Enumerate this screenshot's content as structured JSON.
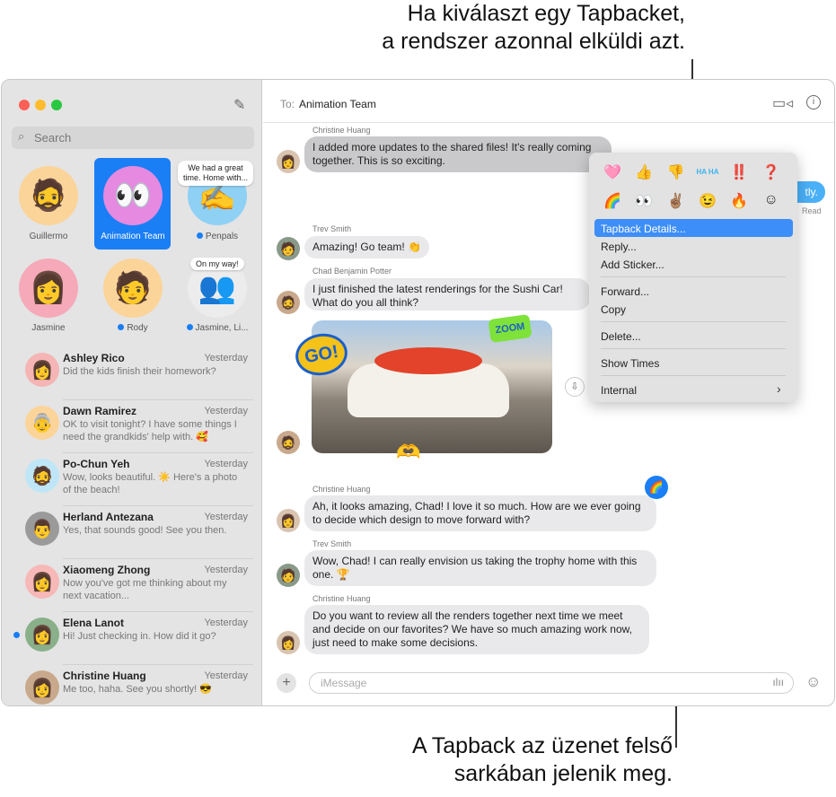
{
  "callouts": {
    "top": [
      "Ha kiválaszt egy Tapbacket,",
      "a rendszer azonnal elküldi azt."
    ],
    "bottom": [
      "A Tapback az üzenet felső",
      "sarkában jelenik meg."
    ]
  },
  "sidebar": {
    "search_placeholder": "Search",
    "pinned": [
      {
        "name": "Guillermo",
        "emoji": "🧔"
      },
      {
        "name": "Animation Team",
        "emoji": "👀"
      },
      {
        "name": "Penpals",
        "emoji": "✍️",
        "bubble": "We had a great time. Home with..."
      },
      {
        "name": "Jasmine",
        "emoji": "👩"
      },
      {
        "name": "Rody",
        "emoji": "🧑"
      },
      {
        "name": "Jasmine, Li...",
        "emoji": "👥",
        "bubble": "On my way!"
      }
    ],
    "conversations": [
      {
        "name": "Ashley Rico",
        "time": "Yesterday",
        "preview": "Did the kids finish their homework?",
        "emoji": "👩",
        "color": "#f5b5b5"
      },
      {
        "name": "Dawn Ramirez",
        "time": "Yesterday",
        "preview": "OK to visit tonight? I have some things I need the grandkids' help with. 🥰",
        "emoji": "👵",
        "color": "#fbd49a"
      },
      {
        "name": "Po-Chun Yeh",
        "time": "Yesterday",
        "preview": "Wow, looks beautiful. ☀️ Here's a photo of the beach!",
        "emoji": "🧔",
        "color": "#bfe6f7"
      },
      {
        "name": "Herland Antezana",
        "time": "Yesterday",
        "preview": "Yes, that sounds good! See you then.",
        "emoji": "👨",
        "color": "#9a9a9a"
      },
      {
        "name": "Xiaomeng Zhong",
        "time": "Yesterday",
        "preview": "Now you've got me thinking about my next vacation...",
        "emoji": "👩",
        "color": "#f7b8b8"
      },
      {
        "name": "Elena Lanot",
        "time": "Yesterday",
        "preview": "Hi! Just checking in. How did it go?",
        "emoji": "👩",
        "color": "#8ab08a",
        "unread": true
      },
      {
        "name": "Christine Huang",
        "time": "Yesterday",
        "preview": "Me too, haha. See you shortly! 😎",
        "emoji": "👩",
        "color": "#c9a98c"
      }
    ]
  },
  "header": {
    "to_label": "To:",
    "recipient": "Animation Team"
  },
  "messages": [
    {
      "sender": "Christine Huang",
      "text": "I added more updates to the shared files! It's really coming together. This is so exciting."
    },
    {
      "sender": "Trev Smith",
      "text": "Amazing! Go team! 👏"
    },
    {
      "sender": "Chad Benjamin Potter",
      "text": "I just finished the latest renderings for the Sushi Car! What do you all think?"
    },
    {
      "sender": "Christine Huang",
      "text": "Ah, it looks amazing, Chad! I love it so much. How are we ever going to decide which design to move forward with?",
      "tapback": "🌈"
    },
    {
      "sender": "Trev Smith",
      "text": "Wow, Chad! I can really envision us taking the trophy home with this one. 🏆"
    },
    {
      "sender": "Christine Huang",
      "text": "Do you want to review all the renders together next time we meet and decide on our favorites? We have so much amazing work now, just need to make some decisions."
    }
  ],
  "outgoing": {
    "text": "tly.",
    "status": "Read"
  },
  "stickers": {
    "go": "GO!",
    "zoom": "ZOOM"
  },
  "menu": {
    "tapbacks": [
      "🩷",
      "👍",
      "👎",
      "HA HA",
      "‼️",
      "❓",
      "🌈",
      "👀",
      "✌🏽",
      "😉",
      "🔥",
      "☺"
    ],
    "items": [
      "Tapback Details...",
      "Reply...",
      "Add Sticker...",
      "Forward...",
      "Copy",
      "Delete...",
      "Show Times",
      "Internal"
    ]
  },
  "compose": {
    "placeholder": "iMessage"
  },
  "colors": {
    "accent": "#1a7ef5",
    "highlight": "#3d8ef8",
    "outgoing": "#4ab0f7"
  }
}
